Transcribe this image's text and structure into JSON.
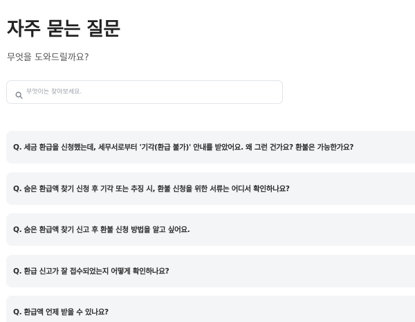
{
  "header": {
    "title": "자주 묻는 질문",
    "subtitle": "무엇을 도와드릴까요?"
  },
  "search": {
    "placeholder": "무엇이든 찾아보세요.",
    "icon": "search-icon"
  },
  "faq": {
    "items": [
      {
        "question": "Q. 세금 환급을 신청했는데, 세무서로부터 '기각(환급 불가)' 안내를 받았어요. 왜 그런 건가요? 환불은 가능한가요?"
      },
      {
        "question": "Q. 숨은 환급액 찾기 신청 후 기각 또는 추징 시, 환불 신청을 위한 서류는 어디서 확인하나요?"
      },
      {
        "question": "Q. 숨은 환급액 찾기 신고 후 환불 신청 방법을 알고 싶어요."
      },
      {
        "question": "Q. 환급 신고가 잘 접수되었는지 어떻게 확인하나요?"
      },
      {
        "question": "Q. 환급액 언제 받을 수 있나요?"
      }
    ]
  }
}
